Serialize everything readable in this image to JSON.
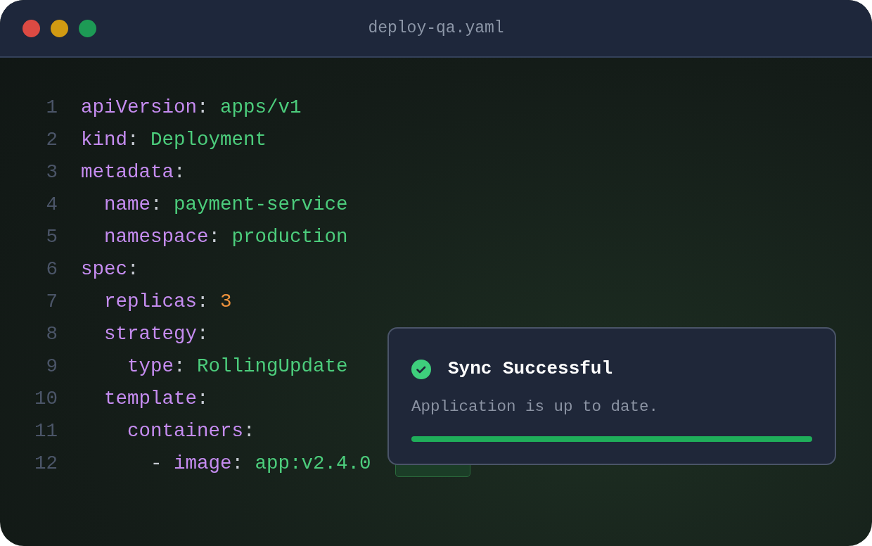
{
  "window": {
    "title": "deploy-qa.yaml"
  },
  "editor": {
    "lines": [
      {
        "number": "1",
        "tokens": [
          {
            "kind": "key",
            "text": "apiVersion"
          },
          {
            "kind": "punct",
            "text": ": "
          },
          {
            "kind": "string",
            "text": "apps/v1"
          }
        ]
      },
      {
        "number": "2",
        "tokens": [
          {
            "kind": "key",
            "text": "kind"
          },
          {
            "kind": "punct",
            "text": ": "
          },
          {
            "kind": "string",
            "text": "Deployment"
          }
        ]
      },
      {
        "number": "3",
        "tokens": [
          {
            "kind": "key",
            "text": "metadata"
          },
          {
            "kind": "punct",
            "text": ":"
          }
        ]
      },
      {
        "number": "4",
        "tokens": [
          {
            "kind": "key",
            "text": "  name"
          },
          {
            "kind": "punct",
            "text": ": "
          },
          {
            "kind": "string",
            "text": "payment-service"
          }
        ]
      },
      {
        "number": "5",
        "tokens": [
          {
            "kind": "key",
            "text": "  namespace"
          },
          {
            "kind": "punct",
            "text": ": "
          },
          {
            "kind": "string",
            "text": "production"
          }
        ]
      },
      {
        "number": "6",
        "tokens": [
          {
            "kind": "key",
            "text": "spec"
          },
          {
            "kind": "punct",
            "text": ":"
          }
        ]
      },
      {
        "number": "7",
        "tokens": [
          {
            "kind": "key",
            "text": "  replicas"
          },
          {
            "kind": "punct",
            "text": ": "
          },
          {
            "kind": "number",
            "text": "3"
          }
        ]
      },
      {
        "number": "8",
        "tokens": [
          {
            "kind": "key",
            "text": "  strategy"
          },
          {
            "kind": "punct",
            "text": ":"
          }
        ]
      },
      {
        "number": "9",
        "tokens": [
          {
            "kind": "key",
            "text": "    type"
          },
          {
            "kind": "punct",
            "text": ": "
          },
          {
            "kind": "string",
            "text": "RollingUpdate"
          }
        ]
      },
      {
        "number": "10",
        "tokens": [
          {
            "kind": "key",
            "text": "  template"
          },
          {
            "kind": "punct",
            "text": ":"
          }
        ]
      },
      {
        "number": "11",
        "tokens": [
          {
            "kind": "key",
            "text": "    containers"
          },
          {
            "kind": "punct",
            "text": ":"
          }
        ]
      },
      {
        "number": "12",
        "tagged": true,
        "tokens": [
          {
            "kind": "punct",
            "text": "      - "
          },
          {
            "kind": "key",
            "text": "image"
          },
          {
            "kind": "punct",
            "text": ": "
          },
          {
            "kind": "string",
            "text": "app:v2.4.0"
          }
        ]
      }
    ]
  },
  "toast": {
    "kind": "success",
    "title": "Sync Successful",
    "message": "Application is up to date.",
    "level": 1
  }
}
